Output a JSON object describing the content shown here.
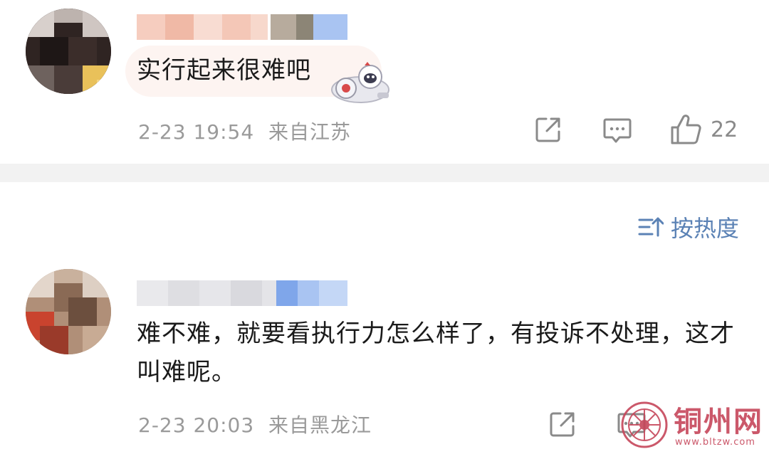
{
  "comments": [
    {
      "text": "实行起来很难吧",
      "timestamp": "2-23 19:54",
      "location": "来自江苏",
      "like_count": "22",
      "actions": [
        "share-icon",
        "comment-icon",
        "like-icon"
      ]
    },
    {
      "text": "难不难，就要看执行力怎么样了，有投诉不处理，这才叫难呢。",
      "timestamp": "2-23 20:03",
      "location": "来自黑龙江",
      "actions": [
        "share-icon",
        "comment-icon"
      ]
    }
  ],
  "sort": {
    "label": "按热度",
    "icon": "sort-icon"
  },
  "watermark": {
    "title": "铜州网",
    "url": "www.bltzw.com"
  },
  "colors": {
    "text": "#1a1a1a",
    "meta": "#9a9a9a",
    "link": "#5b82b5",
    "divider": "#f2f2f2",
    "watermark": "#c6465a"
  }
}
